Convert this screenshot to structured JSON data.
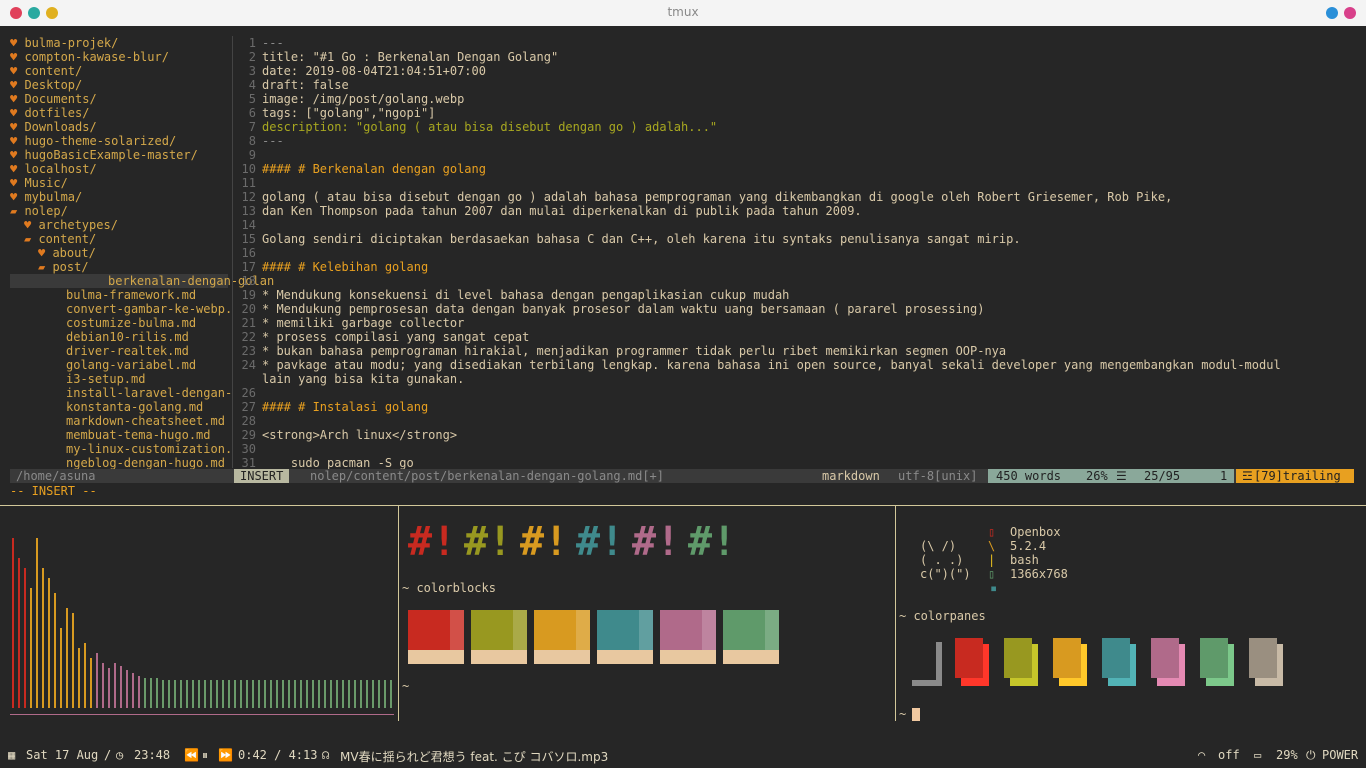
{
  "window": {
    "title": "tmux"
  },
  "tree": {
    "items": [
      {
        "label": "bulma-projek/",
        "indent": 0,
        "icon": "heart"
      },
      {
        "label": "compton-kawase-blur/",
        "indent": 0,
        "icon": "heart"
      },
      {
        "label": "content/",
        "indent": 0,
        "icon": "heart"
      },
      {
        "label": "Desktop/",
        "indent": 0,
        "icon": "heart"
      },
      {
        "label": "Documents/",
        "indent": 0,
        "icon": "heart"
      },
      {
        "label": "dotfiles/",
        "indent": 0,
        "icon": "heart"
      },
      {
        "label": "Downloads/",
        "indent": 0,
        "icon": "heart"
      },
      {
        "label": "hugo-theme-solarized/",
        "indent": 0,
        "icon": "heart"
      },
      {
        "label": "hugoBasicExample-master/",
        "indent": 0,
        "icon": "heart"
      },
      {
        "label": "localhost/",
        "indent": 0,
        "icon": "heart"
      },
      {
        "label": "Music/",
        "indent": 0,
        "icon": "heart"
      },
      {
        "label": "mybulma/",
        "indent": 0,
        "icon": "heart"
      },
      {
        "label": "nolep/",
        "indent": 0,
        "icon": "folder"
      },
      {
        "label": "archetypes/",
        "indent": 1,
        "icon": "heart"
      },
      {
        "label": "content/",
        "indent": 1,
        "icon": "folder"
      },
      {
        "label": "about/",
        "indent": 2,
        "icon": "heart"
      },
      {
        "label": "post/",
        "indent": 2,
        "icon": "folder"
      },
      {
        "label": "berkenalan-dengan-golan",
        "indent": 3,
        "icon": "none",
        "selected": true
      },
      {
        "label": "bulma-framework.md",
        "indent": 3,
        "icon": "none"
      },
      {
        "label": "convert-gambar-ke-webp.",
        "indent": 3,
        "icon": "none"
      },
      {
        "label": "costumize-bulma.md",
        "indent": 3,
        "icon": "none"
      },
      {
        "label": "debian10-rilis.md",
        "indent": 3,
        "icon": "none"
      },
      {
        "label": "driver-realtek.md",
        "indent": 3,
        "icon": "none"
      },
      {
        "label": "golang-variabel.md",
        "indent": 3,
        "icon": "none"
      },
      {
        "label": "i3-setup.md",
        "indent": 3,
        "icon": "none"
      },
      {
        "label": "install-laravel-dengan-",
        "indent": 3,
        "icon": "none"
      },
      {
        "label": "konstanta-golang.md",
        "indent": 3,
        "icon": "none"
      },
      {
        "label": "markdown-cheatsheet.md",
        "indent": 3,
        "icon": "none"
      },
      {
        "label": "membuat-tema-hugo.md",
        "indent": 3,
        "icon": "none"
      },
      {
        "label": "my-linux-customization.",
        "indent": 3,
        "icon": "none"
      },
      {
        "label": "ngeblog-dengan-hugo.md",
        "indent": 3,
        "icon": "none"
      }
    ],
    "cwd": "/home/asuna"
  },
  "editor": {
    "lines": [
      {
        "n": "1",
        "text": "---",
        "kind": "meta"
      },
      {
        "n": "2",
        "text": "title: \"#1 Go : Berkenalan Dengan Golang\"",
        "kind": "normal"
      },
      {
        "n": "3",
        "text": "date: 2019-08-04T21:04:51+07:00",
        "kind": "normal"
      },
      {
        "n": "4",
        "text": "draft: false",
        "kind": "normal"
      },
      {
        "n": "5",
        "text": "image: /img/post/golang.webp",
        "kind": "normal"
      },
      {
        "n": "6",
        "text": "tags: [\"golang\",\"ngopi\"]",
        "kind": "normal"
      },
      {
        "n": "7",
        "text": "description: \"golang ( atau bisa disebut dengan go ) adalah...\"",
        "kind": "desc"
      },
      {
        "n": "8",
        "text": "---",
        "kind": "meta"
      },
      {
        "n": "9",
        "text": "",
        "kind": "normal"
      },
      {
        "n": "10",
        "text": "#### # Berkenalan dengan golang",
        "kind": "heading"
      },
      {
        "n": "11",
        "text": "",
        "kind": "normal"
      },
      {
        "n": "12",
        "text": "golang ( atau bisa disebut dengan go ) adalah bahasa pemprograman yang dikembangkan di google oleh Robert Griesemer, Rob Pike,",
        "kind": "normal"
      },
      {
        "n": "13",
        "text": "dan Ken Thompson pada tahun 2007 dan mulai diperkenalkan di publik pada tahun 2009.",
        "kind": "normal"
      },
      {
        "n": "14",
        "text": "",
        "kind": "normal"
      },
      {
        "n": "15",
        "text": "Golang sendiri diciptakan berdasaekan bahasa C dan C++, oleh karena itu syntaks penulisanya sangat mirip.",
        "kind": "normal"
      },
      {
        "n": "16",
        "text": "",
        "kind": "normal"
      },
      {
        "n": "17",
        "text": "#### # Kelebihan golang",
        "kind": "heading"
      },
      {
        "n": "18",
        "text": "",
        "kind": "normal"
      },
      {
        "n": "19",
        "text": "* Mendukung konsekuensi di level bahasa dengan pengaplikasian cukup mudah",
        "kind": "normal"
      },
      {
        "n": "20",
        "text": "* Mendukung pemprosesan data dengan banyak prosesor dalam waktu uang bersamaan ( pararel prosessing)",
        "kind": "normal"
      },
      {
        "n": "21",
        "text": "* memiliki garbage collector",
        "kind": "normal"
      },
      {
        "n": "22",
        "text": "* prosess compilasi yang sangat cepat",
        "kind": "normal"
      },
      {
        "n": "23",
        "text": "* bukan bahasa pemprograman hirakial, menjadikan programmer tidak perlu ribet memikirkan segmen OOP-nya",
        "kind": "normal"
      },
      {
        "n": "24",
        "text": "* pavkage atau modu; yang disediakan terbilang lengkap. karena bahasa ini open source, banyal sekali developer yang mengembangkan modul-modul",
        "kind": "normal"
      },
      {
        "n": "",
        "text": "lain yang bisa kita gunakan.",
        "kind": "normal"
      },
      {
        "n": "26",
        "text": "",
        "kind": "normal"
      },
      {
        "n": "27",
        "text": "#### # Instalasi golang",
        "kind": "heading"
      },
      {
        "n": "28",
        "text": "",
        "kind": "normal"
      },
      {
        "n": "29",
        "text": "<strong>Arch linux</strong>",
        "kind": "normal"
      },
      {
        "n": "30",
        "text": "",
        "kind": "normal"
      },
      {
        "n": "31",
        "text": "    sudo pacman -S go",
        "kind": "normal"
      }
    ]
  },
  "statusline": {
    "mode": "INSERT",
    "file": "nolep/content/post/berkenalan-dengan-golang.md[+]",
    "filetype": "markdown",
    "encoding": "utf-8[unix]",
    "words": "450 words",
    "percent": "26%",
    "position": "25/95",
    "col": "1",
    "trailing": "[79]trailing",
    "insert_msg": "-- INSERT --"
  },
  "panes": {
    "colorblocks_prompt": "~ colorblocks",
    "colorblocks_hashes": [
      "#!",
      "#!",
      "#!",
      "#!",
      "#!",
      "#!"
    ],
    "prompt_tilde": "~",
    "fetch": {
      "ascii": [
        "(\\ /)",
        "( . .)",
        "c(\")(\")"
      ],
      "wm": "Openbox",
      "version": "5.2.4",
      "shell": "bash",
      "resolution": "1366x768"
    },
    "colorpanes_prompt": "~ colorpanes",
    "cursor_prompt": "~"
  },
  "bottom": {
    "date": "Sat 17 Aug",
    "time": "23:48",
    "track_time": "0:42 / 4:13",
    "track": "MV春に揺られど君想う feat. こぴ コバソロ.mp3",
    "wifi": "off",
    "battery": "29%",
    "power": "POWER"
  },
  "colors": {
    "red": "#c82a20",
    "olive": "#989820",
    "orange": "#d89a20",
    "teal": "#3f8a8c",
    "pink": "#b06a8a",
    "green": "#5f9a6a",
    "gray": "#9a8f80"
  }
}
